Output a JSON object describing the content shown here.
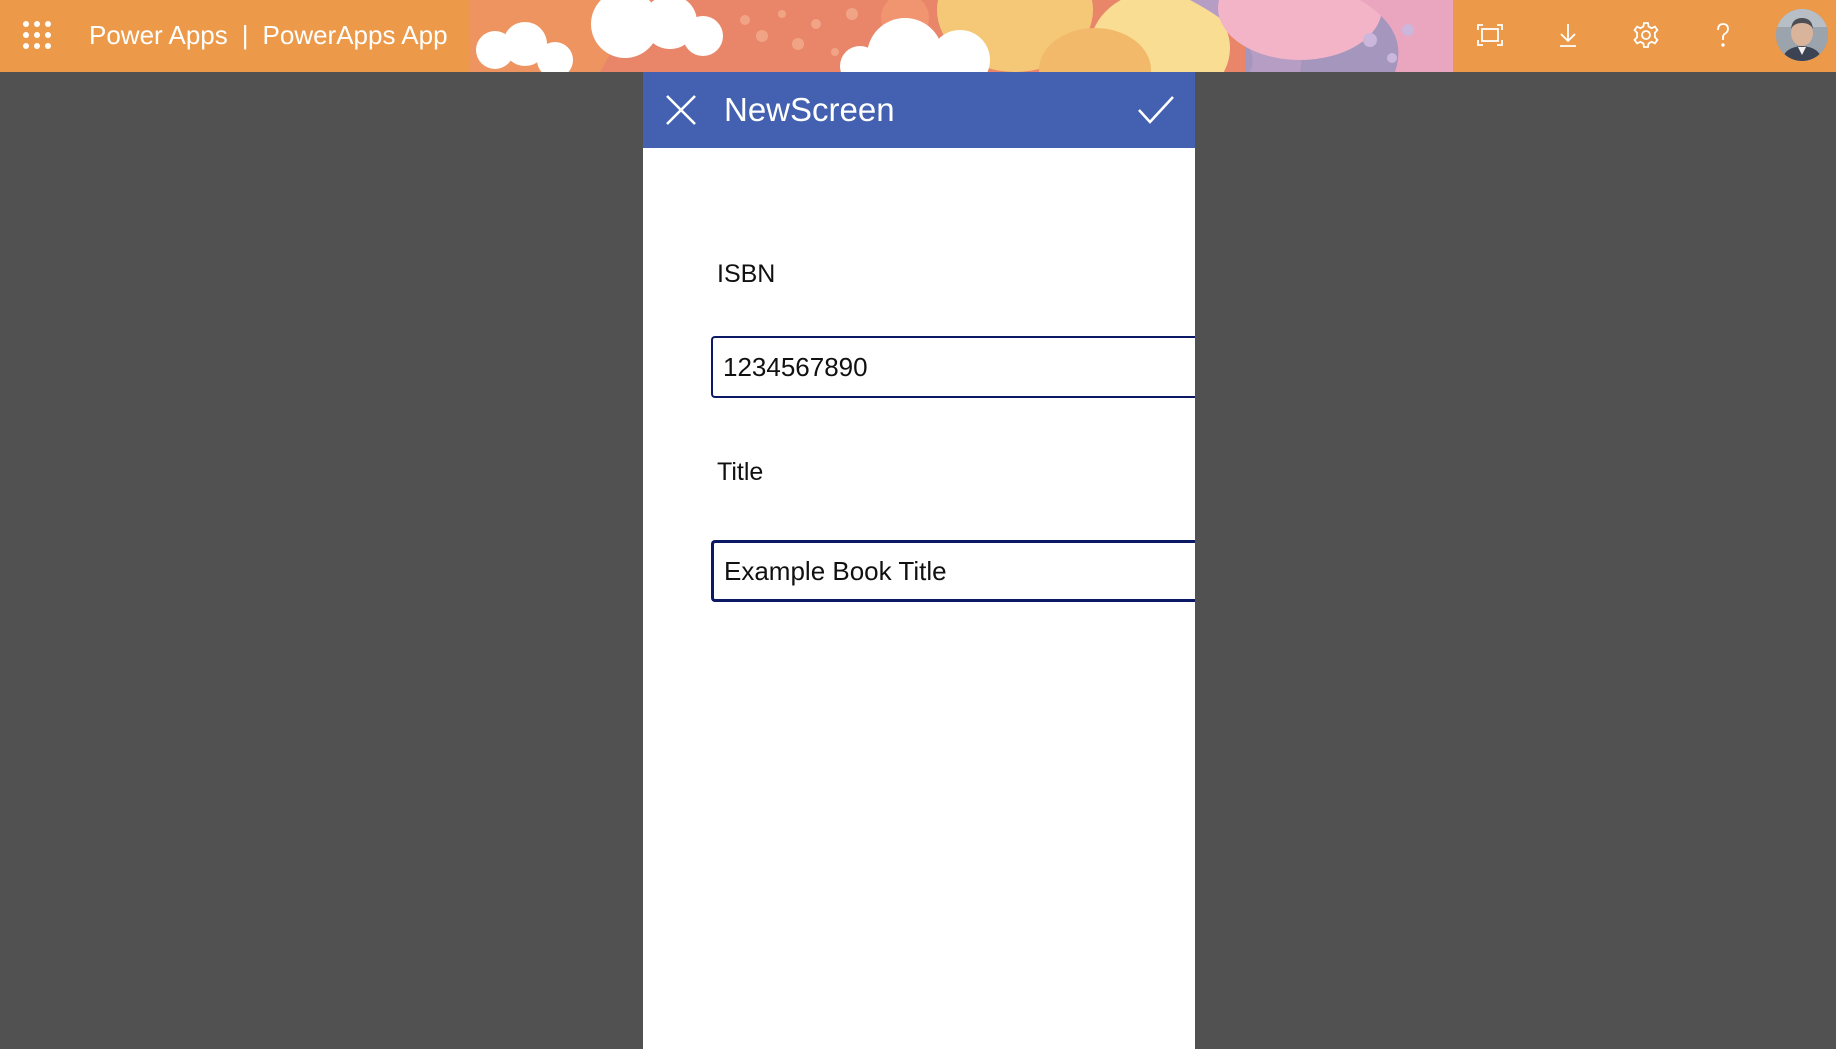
{
  "header": {
    "brand": "Power Apps",
    "separator": "|",
    "app_name": "PowerApps App",
    "icons": [
      "app-launcher-icon",
      "fit-to-screen-icon",
      "download-icon",
      "settings-icon",
      "help-icon"
    ],
    "accent_color": "#ec9a4a"
  },
  "screen": {
    "title": "NewScreen",
    "header_color": "#4361b0",
    "icons": [
      "close-icon",
      "checkmark-icon"
    ]
  },
  "form": {
    "isbn_label": "ISBN",
    "isbn_value": "1234567890",
    "title_label": "Title",
    "title_value": "Example Book Title"
  }
}
